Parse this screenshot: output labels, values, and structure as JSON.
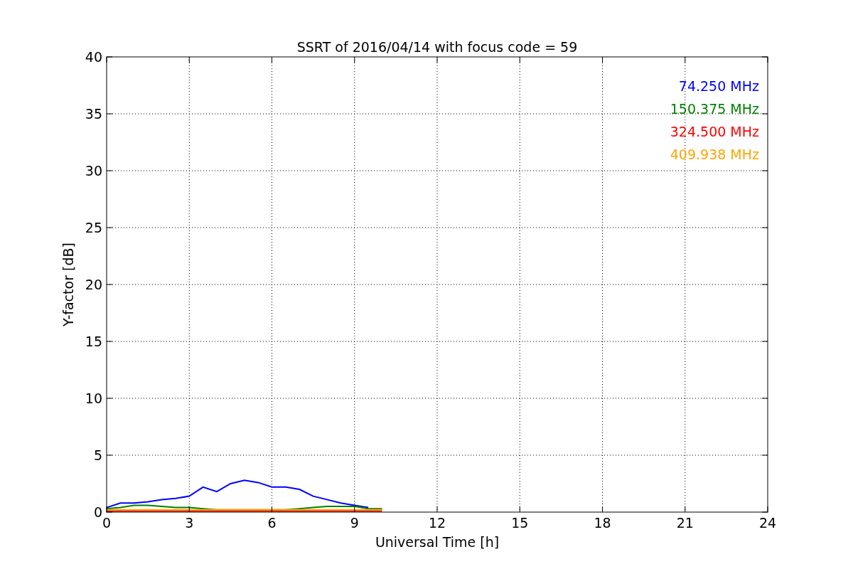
{
  "chart_data": {
    "type": "line",
    "title": "SSRT of 2016/04/14 with focus code = 59",
    "xlabel": "Universal Time [h]",
    "ylabel": "Y-factor [dB]",
    "x": [
      0,
      0.5,
      1,
      1.5,
      2,
      2.5,
      3,
      3.5,
      4,
      4.5,
      5,
      5.5,
      6,
      6.5,
      7,
      7.5,
      8,
      8.5,
      9,
      9.5,
      10
    ],
    "series": [
      {
        "name": "74.250 MHz",
        "color": "#0000ff",
        "values": [
          0.4,
          0.8,
          0.8,
          0.9,
          1.1,
          1.2,
          1.4,
          2.2,
          1.8,
          2.5,
          2.8,
          2.6,
          2.2,
          2.2,
          2.0,
          1.4,
          1.1,
          0.8,
          0.6,
          0.4,
          null
        ]
      },
      {
        "name": "150.375 MHz",
        "color": "#008000",
        "values": [
          0.3,
          0.4,
          0.6,
          0.6,
          0.5,
          0.4,
          0.4,
          0.3,
          0.2,
          0.2,
          0.2,
          0.2,
          0.2,
          0.2,
          0.3,
          0.4,
          0.5,
          0.5,
          0.5,
          0.3,
          0.3
        ]
      },
      {
        "name": "324.500 MHz",
        "color": "#ff0000",
        "values": [
          0.1,
          0.1,
          0.1,
          0.1,
          0.1,
          0.1,
          0.1,
          0.1,
          0.1,
          0.1,
          0.1,
          0.1,
          0.1,
          0.1,
          0.1,
          0.1,
          0.1,
          0.1,
          0.1,
          0.1,
          0.1
        ]
      },
      {
        "name": "409.938 MHz",
        "color": "#ffa500",
        "values": [
          0.2,
          0.2,
          0.2,
          0.2,
          0.2,
          0.2,
          0.2,
          0.2,
          0.2,
          0.2,
          0.2,
          0.2,
          0.2,
          0.2,
          0.2,
          0.2,
          0.2,
          0.2,
          0.2,
          0.2,
          0.2
        ]
      }
    ],
    "xlim": [
      0,
      24
    ],
    "ylim": [
      0,
      40
    ],
    "xticks": [
      0,
      3,
      6,
      9,
      12,
      15,
      18,
      21,
      24
    ],
    "yticks": [
      0,
      5,
      10,
      15,
      20,
      25,
      30,
      35,
      40
    ],
    "grid": true
  }
}
